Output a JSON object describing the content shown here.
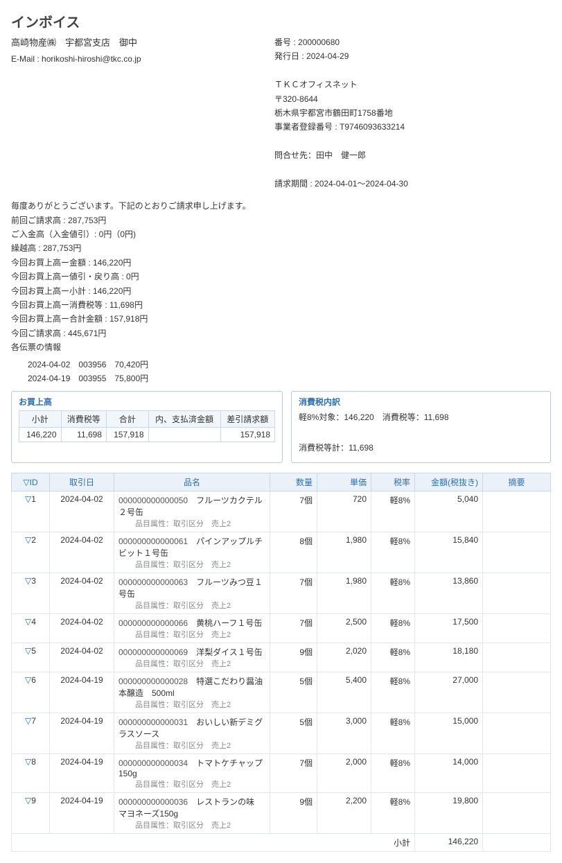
{
  "title": "インボイス",
  "customer": "高崎物産㈱　宇都宮支店　御中",
  "email_label": "E-Mail : ",
  "email": "horikoshi-hiroshi@tkc.co.jp",
  "header": {
    "no_label": "番号 : ",
    "no": "200000680",
    "issue_label": "発行日 : ",
    "issue": "2024-04-29",
    "company": "ＴＫＣオフィスネット",
    "zip": "〒320-8644",
    "addr": "栃木県宇都宮市鶴田町1758番地",
    "reg_label": "事業者登録番号 : ",
    "reg": "T9746093633214",
    "contact_label": "問合せ先：",
    "contact": "田中　健一郎",
    "period_label": "請求期間 : ",
    "period": "2024-04-01～2024-04-30"
  },
  "intro": {
    "l1": "毎度ありがとうございます。下記のとおりご請求申し上げます。",
    "l2": "前回ご請求高 : 287,753円",
    "l3": "ご入金高（入金値引）: 0円（0円)",
    "l4": "繰越高 : 287,753円",
    "l5": "今回お買上高ー金額 : 146,220円",
    "l6": "今回お買上高ー値引・戻り高 : 0円",
    "l7": "今回お買上高ー小計 : 146,220円",
    "l8": "今回お買上高ー消費税等 : 11,698円",
    "l9": "今回お買上高ー合計金額 : 157,918円",
    "l10": "今回ご請求高 : 445,671円",
    "l11": "各伝票の情報"
  },
  "vouchers": [
    "2024-04-02　003956　70,420円",
    "2024-04-19　003955　75,800円"
  ],
  "panel1": {
    "title": "お買上高",
    "h1": "小計",
    "h2": "消費税等",
    "h3": "合計",
    "h4": "内、支払済金額",
    "h5": "差引請求額",
    "v1": "146,220",
    "v2": "11,698",
    "v3": "157,918",
    "v4": "",
    "v5": "157,918"
  },
  "panel2": {
    "title": "消費税内訳",
    "line1": "軽8%対象：146,220　消費税等：11,698",
    "line2": "消費税等計：11,698"
  },
  "cols": {
    "id": "ID",
    "date": "取引日",
    "name": "品名",
    "qty": "数量",
    "price": "単価",
    "rate": "税率",
    "amount": "金額(税抜き)",
    "remark": "摘要"
  },
  "sub_text": "品目属性：取引区分　売上2",
  "rows": [
    {
      "id": "1",
      "date": "2024-04-02",
      "code": "000000000000050",
      "name": "フルーツカクテル２号缶",
      "qty": "7個",
      "price": "720",
      "rate": "軽8%",
      "amount": "5,040"
    },
    {
      "id": "2",
      "date": "2024-04-02",
      "code": "000000000000061",
      "name": "パインアップルチビット１号缶",
      "qty": "8個",
      "price": "1,980",
      "rate": "軽8%",
      "amount": "15,840"
    },
    {
      "id": "3",
      "date": "2024-04-02",
      "code": "000000000000063",
      "name": "フルーツみつ豆１号缶",
      "qty": "7個",
      "price": "1,980",
      "rate": "軽8%",
      "amount": "13,860"
    },
    {
      "id": "4",
      "date": "2024-04-02",
      "code": "000000000000066",
      "name": "黄桃ハーフ１号缶",
      "qty": "7個",
      "price": "2,500",
      "rate": "軽8%",
      "amount": "17,500"
    },
    {
      "id": "5",
      "date": "2024-04-02",
      "code": "000000000000069",
      "name": "洋梨ダイス１号缶",
      "qty": "9個",
      "price": "2,020",
      "rate": "軽8%",
      "amount": "18,180"
    },
    {
      "id": "6",
      "date": "2024-04-19",
      "code": "000000000000028",
      "name": "特選こだわり醤油　本醸造　500ml",
      "qty": "5個",
      "price": "5,400",
      "rate": "軽8%",
      "amount": "27,000"
    },
    {
      "id": "7",
      "date": "2024-04-19",
      "code": "000000000000031",
      "name": "おいしい新デミグラスソース",
      "qty": "5個",
      "price": "3,000",
      "rate": "軽8%",
      "amount": "15,000"
    },
    {
      "id": "8",
      "date": "2024-04-19",
      "code": "000000000000034",
      "name": "トマトケチャップ　150g",
      "qty": "7個",
      "price": "2,000",
      "rate": "軽8%",
      "amount": "14,000"
    },
    {
      "id": "9",
      "date": "2024-04-19",
      "code": "000000000000036",
      "name": "レストランの味　マヨネーズ150g",
      "qty": "9個",
      "price": "2,200",
      "rate": "軽8%",
      "amount": "19,800"
    }
  ],
  "subtotal": {
    "label": "小計",
    "value": "146,220"
  }
}
